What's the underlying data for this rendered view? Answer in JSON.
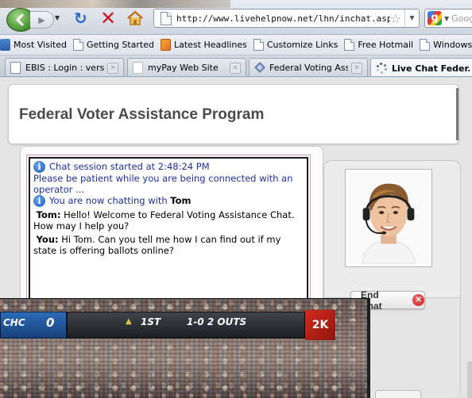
{
  "browser": {
    "url": "http://www.livehelpnow.net/lhn/inchat.aspx",
    "search_placeholder": "Goog"
  },
  "bookmarks": [
    {
      "label": "Most Visited",
      "icon": "bookmarks-star-icon"
    },
    {
      "label": "Getting Started",
      "icon": "page-icon"
    },
    {
      "label": "Latest Headlines",
      "icon": "rss-icon"
    },
    {
      "label": "Customize Links",
      "icon": "page-icon"
    },
    {
      "label": "Free Hotmail",
      "icon": "page-icon"
    },
    {
      "label": "Windows Marketpl",
      "icon": "page-icon"
    }
  ],
  "tabs": [
    {
      "label": "EBIS : Login : versi..."
    },
    {
      "label": "myPay Web Site"
    },
    {
      "label": "Federal Voting Assi..."
    },
    {
      "label": "Live Chat Feder..."
    }
  ],
  "page": {
    "title": "Federal Voter Assistance Program",
    "end_chat_label": "End Chat"
  },
  "chat": {
    "session_started": "Chat session started at 2:48:24 PM",
    "please_wait": "Please be patient while you are being connected with an operator ...",
    "now_chatting_prefix": "You are now chatting with",
    "operator_name": "Tom",
    "messages": [
      {
        "who": "Tom:",
        "text": "Hello! Welcome to Federal Voting Assistance Chat. How may I help you?"
      },
      {
        "who": "You:",
        "text": "Hi Tom. Can you tell me how I can find out if my state is offering ballots online?"
      }
    ]
  },
  "video": {
    "team": "CHC",
    "runs": "0",
    "inning": "1ST",
    "count": "1-0 2 OUTS",
    "logo": "2K"
  }
}
